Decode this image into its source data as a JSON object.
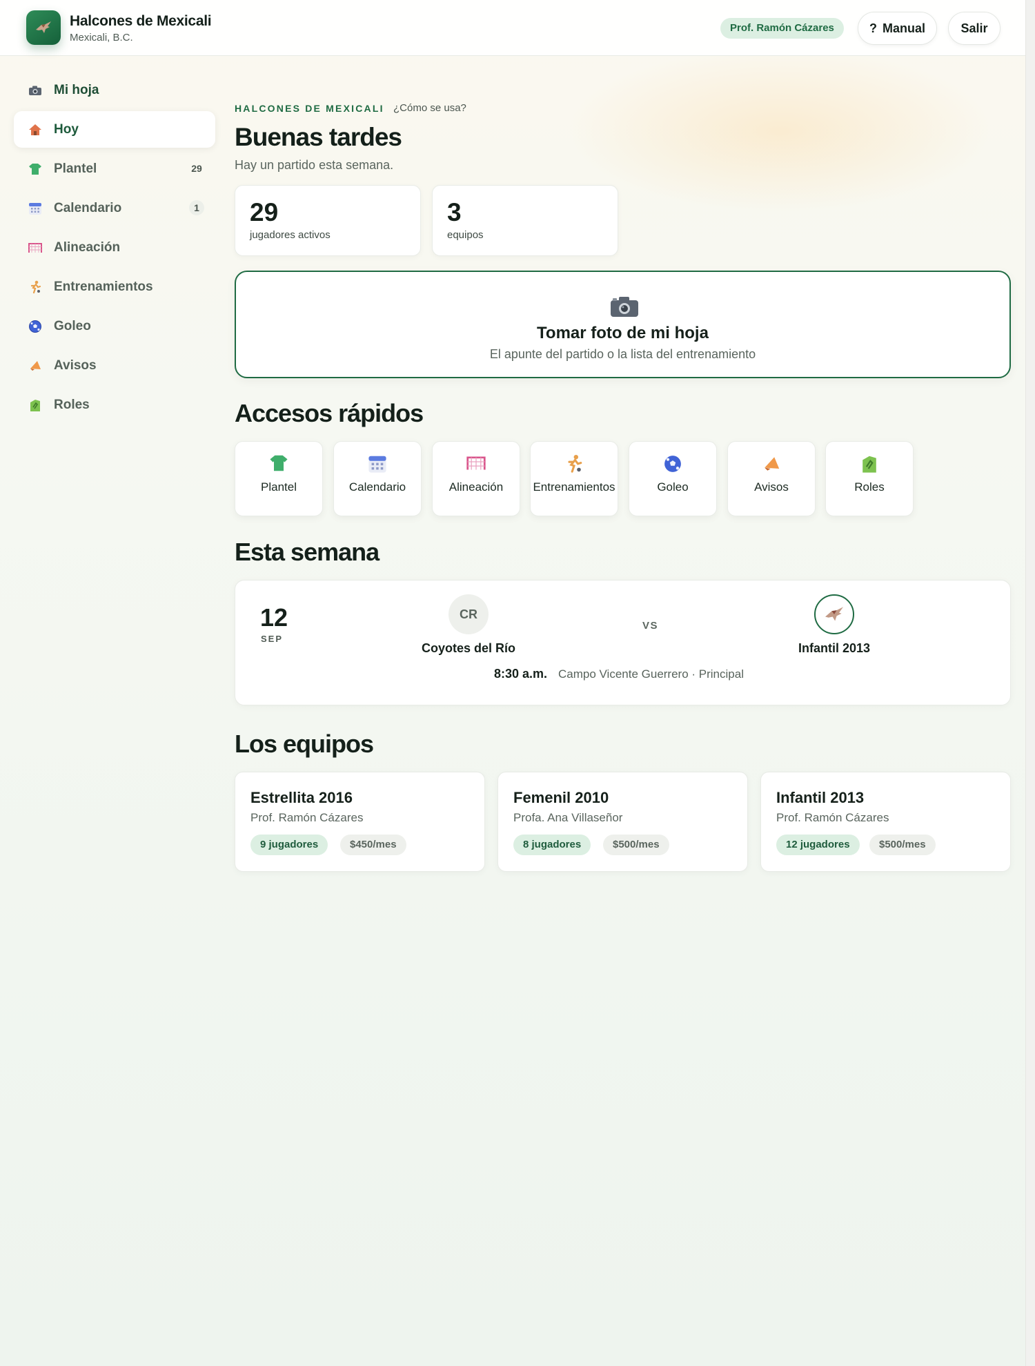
{
  "header": {
    "app_name": "Halcones de Mexicali",
    "location": "Mexicali, B.C.",
    "user_name": "Prof. Ramón Cázares",
    "manual_icon": "?",
    "manual_label": "Manual",
    "logout_label": "Salir"
  },
  "sidebar": {
    "items": [
      {
        "label": "Mi hoja",
        "icon": "camera-icon"
      },
      {
        "label": "Hoy",
        "icon": "house-icon",
        "active": true
      },
      {
        "label": "Plantel",
        "icon": "jersey-icon",
        "count": "29"
      },
      {
        "label": "Calendario",
        "icon": "calendar-icon",
        "count": "1"
      },
      {
        "label": "Alineación",
        "icon": "goal-net-icon"
      },
      {
        "label": "Entrenamientos",
        "icon": "runner-icon"
      },
      {
        "label": "Goleo",
        "icon": "soccer-ball-icon"
      },
      {
        "label": "Avisos",
        "icon": "megaphone-icon"
      },
      {
        "label": "Roles",
        "icon": "clipboard-icon"
      }
    ]
  },
  "main": {
    "eyebrow": "HALCONES DE MEXICALI",
    "help_link": "¿Cómo se usa?",
    "greeting": "Buenas tardes",
    "subtitle": "Hay un partido esta semana.",
    "stats": [
      {
        "value": "29",
        "label": "jugadores activos"
      },
      {
        "value": "3",
        "label": "equipos"
      }
    ],
    "photo_card": {
      "title": "Tomar foto de mi hoja",
      "subtitle": "El apunte del partido o la lista del entrenamiento"
    },
    "quick_title": "Accesos rápidos",
    "quick_links": [
      {
        "label": "Plantel",
        "icon": "jersey-icon"
      },
      {
        "label": "Calendario",
        "icon": "calendar-icon"
      },
      {
        "label": "Alineación",
        "icon": "goal-net-icon"
      },
      {
        "label": "Entrenamientos",
        "icon": "runner-icon"
      },
      {
        "label": "Goleo",
        "icon": "soccer-ball-icon"
      },
      {
        "label": "Avisos",
        "icon": "megaphone-icon"
      },
      {
        "label": "Roles",
        "icon": "clipboard-icon"
      }
    ],
    "week_title": "Esta semana",
    "match": {
      "day": "12",
      "month": "SEP",
      "home_initials": "CR",
      "home_team": "Coyotes del Río",
      "vs": "VS",
      "away_team": "Infantil 2013",
      "time": "8:30 a.m.",
      "venue": "Campo Vicente Guerrero · Principal"
    },
    "teams_title": "Los equipos",
    "teams": [
      {
        "name": "Estrellita 2016",
        "coach": "Prof. Ramón Cázares",
        "players": "9 jugadores",
        "fee": "$450/mes"
      },
      {
        "name": "Femenil 2010",
        "coach": "Profa. Ana Villaseñor",
        "players": "8 jugadores",
        "fee": "$500/mes"
      },
      {
        "name": "Infantil 2013",
        "coach": "Prof. Ramón Cázares",
        "players": "12 jugadores",
        "fee": "$500/mes"
      }
    ]
  },
  "colors": {
    "brand_green": "#1f6b43",
    "pill_green_bg": "#dcefe2",
    "neutral_pill_bg": "#eef0ec"
  }
}
